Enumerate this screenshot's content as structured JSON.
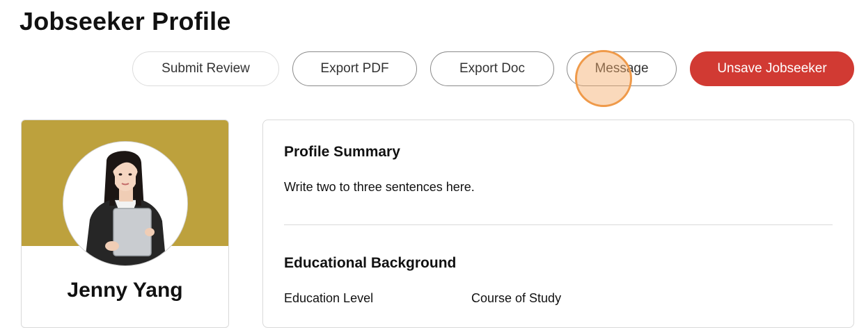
{
  "page": {
    "title": "Jobseeker Profile"
  },
  "actions": {
    "submit_review": "Submit Review",
    "export_pdf": "Export PDF",
    "export_doc": "Export Doc",
    "message": "Message",
    "unsave": "Unsave Jobseeker"
  },
  "colors": {
    "primary_red": "#d13a33",
    "banner_gold": "#bda13d",
    "click_marker_orange": "#ef9a4a"
  },
  "profile": {
    "name": "Jenny Yang",
    "avatar_icon": "avatar-photo"
  },
  "summary": {
    "heading": "Profile Summary",
    "text": "Write two to three sentences here."
  },
  "education": {
    "heading": "Educational Background",
    "columns": [
      "Education Level",
      "Course of Study"
    ]
  }
}
